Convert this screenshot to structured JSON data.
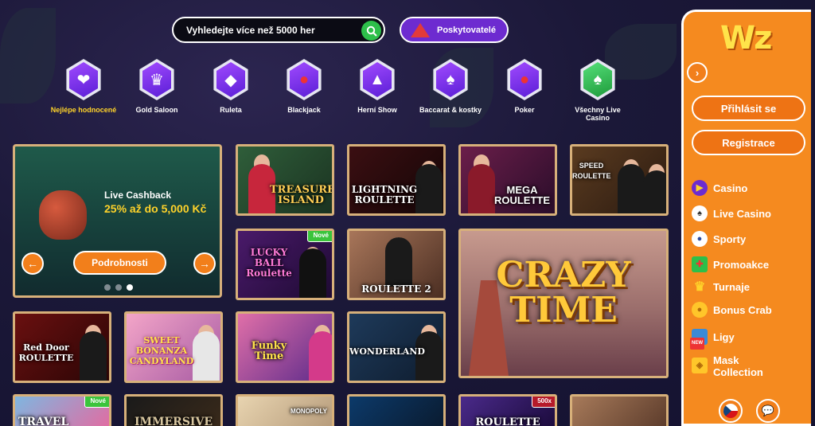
{
  "search": {
    "placeholder": "Vyhledejte více než 5000 her"
  },
  "providers_label": "Poskytovatelé",
  "categories": [
    {
      "label": "Nejlépe hodnocené",
      "icon": "heart-icon"
    },
    {
      "label": "Gold Saloon",
      "icon": "crown-icon"
    },
    {
      "label": "Ruleta",
      "icon": "diamond-icon"
    },
    {
      "label": "Blackjack",
      "icon": "chips-icon"
    },
    {
      "label": "Herní Show",
      "icon": "top-hat-icon"
    },
    {
      "label": "Baccarat & kostky",
      "icon": "spade-card-icon"
    },
    {
      "label": "Poker",
      "icon": "chips-icon"
    },
    {
      "label": "Všechny Live Casino",
      "icon": "spade-icon"
    }
  ],
  "promo": {
    "title": "Live Cashback",
    "subtitle": "25% až do 5,000 Kč",
    "button": "Podrobnosti"
  },
  "games": [
    {
      "title": "TREASURE ISLAND"
    },
    {
      "title": "LIGHTNING ROULETTE"
    },
    {
      "title": "MEGA ROULETTE"
    },
    {
      "title": "SPEED ROULETTE"
    },
    {
      "title": "LUCKY BALL Roulette",
      "badge": "Nové"
    },
    {
      "title": "ROULETTE 2"
    },
    {
      "title": "CRAZY TIME"
    },
    {
      "title": "Red Door ROULETTE"
    },
    {
      "title": "SWEET BONANZA CANDYLAND"
    },
    {
      "title": "Funky Time"
    },
    {
      "title": "WONDERLAND"
    },
    {
      "title": "TRAVEL",
      "badge": "Nové"
    },
    {
      "title": "IMMERSIVE"
    },
    {
      "title": "MONOPOLY"
    },
    {
      "title": ""
    },
    {
      "title": "ROULETTE",
      "badge": "500x"
    },
    {
      "title": ""
    }
  ],
  "sidebar": {
    "logo": "Wz",
    "login": "Přihlásit se",
    "register": "Registrace",
    "nav": [
      {
        "label": "Casino",
        "icon": "play-icon"
      },
      {
        "label": "Live Casino",
        "icon": "dealer-icon"
      },
      {
        "label": "Sporty",
        "icon": "soccer-ball-icon"
      },
      {
        "label": "Promoakce",
        "icon": "gift-icon"
      },
      {
        "label": "Turnaje",
        "icon": "trophy-icon"
      },
      {
        "label": "Bonus Crab",
        "icon": "coin-icon"
      },
      {
        "label": "Ligy",
        "icon": "league-icon",
        "badge": "NEW"
      },
      {
        "label": "Mask Collection",
        "icon": "mask-icon"
      }
    ]
  },
  "colors": {
    "accent": "#f58a1f",
    "brand_purple": "#6d2bd0",
    "highlight": "#ffd32a",
    "frame": "#d7b07a"
  }
}
